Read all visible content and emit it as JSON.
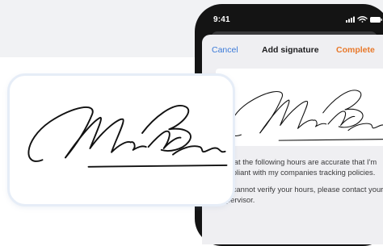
{
  "status_bar": {
    "time": "9:41",
    "icons": [
      "signal-icon",
      "wifi-icon",
      "battery-icon"
    ]
  },
  "nav": {
    "cancel_label": "Cancel",
    "title": "Add signature",
    "complete_label": "Complete"
  },
  "terms": {
    "paragraph_1": "ify that the following hours are accurate that I'm compliant with my companies tracking policies.",
    "paragraph_2": "you cannot verify your hours, please contact your supervisor."
  },
  "colors": {
    "accent_blue": "#3b7ad8",
    "accent_orange": "#e8782a",
    "background_band": "#f1f2f4",
    "phone_frame": "#141414"
  }
}
